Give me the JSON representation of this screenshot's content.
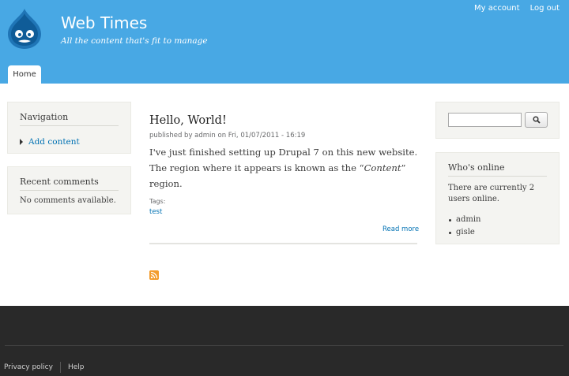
{
  "header": {
    "site_name": "Web Times",
    "slogan": "All the content that's fit to manage",
    "secondary_menu": [
      "My account",
      "Log out"
    ],
    "main_menu": [
      "Home"
    ]
  },
  "sidebar_first": {
    "navigation": {
      "title": "Navigation",
      "links": [
        "Add content"
      ]
    },
    "recent_comments": {
      "title": "Recent comments",
      "text": "No comments available."
    }
  },
  "node": {
    "title": "Hello, World!",
    "submitted": "published by admin on Fri, 01/07/2011 - 16:19",
    "body_line1": "I've just finished setting up Drupal 7 on this new website.",
    "body_line2_pre": "The region where it appears is known as the “",
    "body_line2_em": "Content",
    "body_line2_post": "” region.",
    "tags_label": "Tags:",
    "tags": [
      "test"
    ],
    "read_more": "Read more"
  },
  "sidebar_second": {
    "search": {
      "value": "",
      "button_icon": "magnifier-icon"
    },
    "whos_online": {
      "title": "Who's online",
      "text": "There are currently 2 users online.",
      "users": [
        "admin",
        "gisle"
      ]
    }
  },
  "footer": {
    "links": [
      "Privacy policy",
      "Help"
    ]
  },
  "colors": {
    "header_bg": "#48a8e4",
    "link": "#0071b3",
    "footer_bg": "#292929",
    "sidebar_bg": "#f4f4f1"
  }
}
